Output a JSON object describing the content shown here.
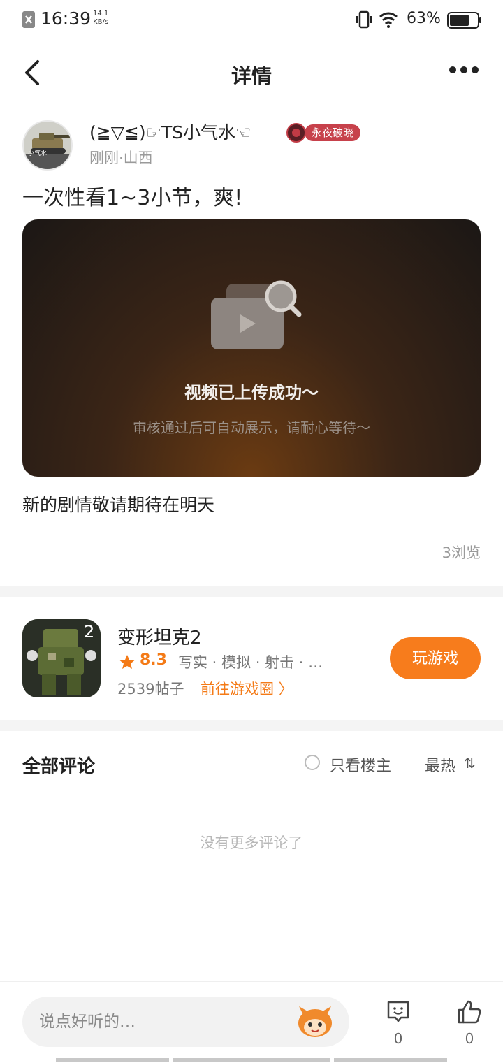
{
  "status_bar": {
    "time": "16:39",
    "speed_value": "14.1",
    "speed_unit": "KB/s",
    "battery": "63%"
  },
  "header": {
    "title": "详情"
  },
  "post": {
    "author": "(≧▽≦)☞TS小气水☜",
    "badge": "永夜破晓",
    "avatar_text": "小气水",
    "meta": "刚刚·山西",
    "title": "一次性看1~3小节，爽!",
    "video_status": "视频已上传成功～",
    "video_note": "审核通过后可自动展示，请耐心等待～",
    "body": "新的剧情敬请期待在明天",
    "views": "3浏览"
  },
  "game": {
    "name": "变形坦克2",
    "rating": "8.3",
    "tags": "写实 · 模拟 · 射击 · …",
    "icon_digit": "2",
    "posts": "2539帖子",
    "circle_link": "前往游戏圈 〉",
    "play_label": "玩游戏"
  },
  "comments": {
    "title": "全部评论",
    "only_host": "只看楼主",
    "sort": "最热",
    "sort_icon": "⇅",
    "empty": "没有更多评论了"
  },
  "bottom_bar": {
    "input_placeholder": "说点好听的…",
    "comment_count": "0",
    "like_count": "0"
  },
  "colors": {
    "accent": "#f77c1c",
    "badge": "#c7414b"
  }
}
